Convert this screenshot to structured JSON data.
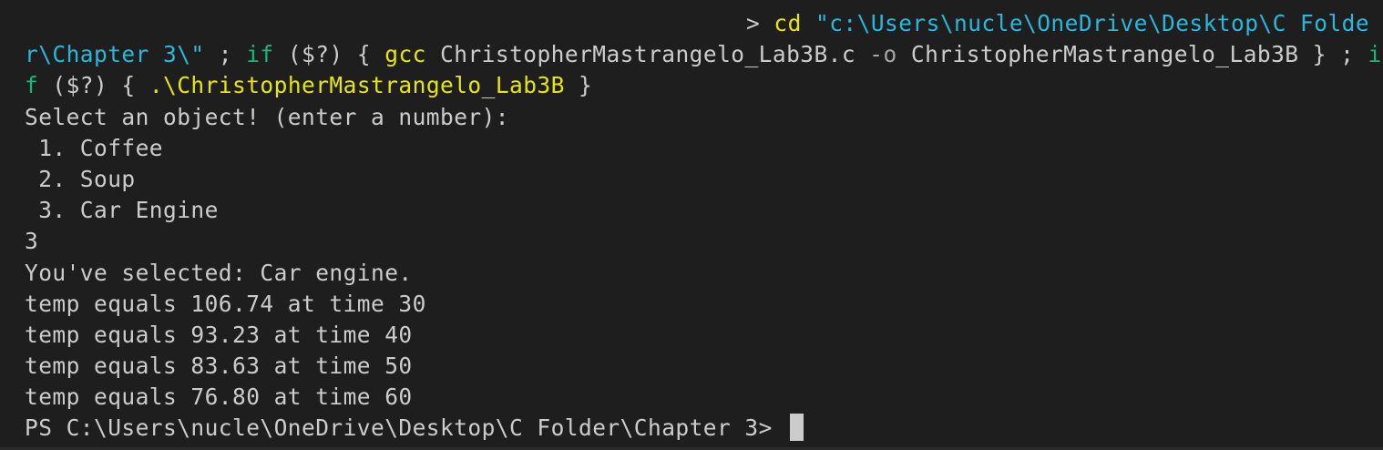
{
  "terminal": {
    "cmd": {
      "gt": ">",
      "cd": "cd",
      "path_part1": "\"c:\\Users\\nucle\\OneDrive\\Desktop\\C Folde",
      "path_part2": "r\\Chapter 3\\\"",
      "semi1": " ; ",
      "if1": "if",
      "cond1": "($?)",
      "brace_open1": "{",
      "gcc": "gcc",
      "src": "ChristopherMastrangelo_Lab3B.c",
      "flag": "-o",
      "out": "ChristopherMastrangelo_Lab3B",
      "brace_close1": "}",
      "semi2": " ; ",
      "if2a": "i",
      "if2b": "f",
      "cond2": "($?)",
      "brace_open2": "{",
      "exe": ".\\ChristopherMastrangelo_Lab3B",
      "brace_close2": "}"
    },
    "output": [
      "Select an object! (enter a number):",
      " 1. Coffee",
      " 2. Soup",
      " 3. Car Engine",
      "3",
      "You've selected: Car engine.",
      "temp equals 106.74 at time 30",
      "temp equals 93.23 at time 40",
      "temp equals 83.63 at time 50",
      "temp equals 76.80 at time 60"
    ],
    "prompt": "PS C:\\Users\\nucle\\OneDrive\\Desktop\\C Folder\\Chapter 3>",
    "colors": {
      "background": "#1e1e1e",
      "foreground": "#cccccc",
      "yellow": "#e5e510",
      "blue": "#29b8db",
      "green": "#0dbc79"
    }
  }
}
